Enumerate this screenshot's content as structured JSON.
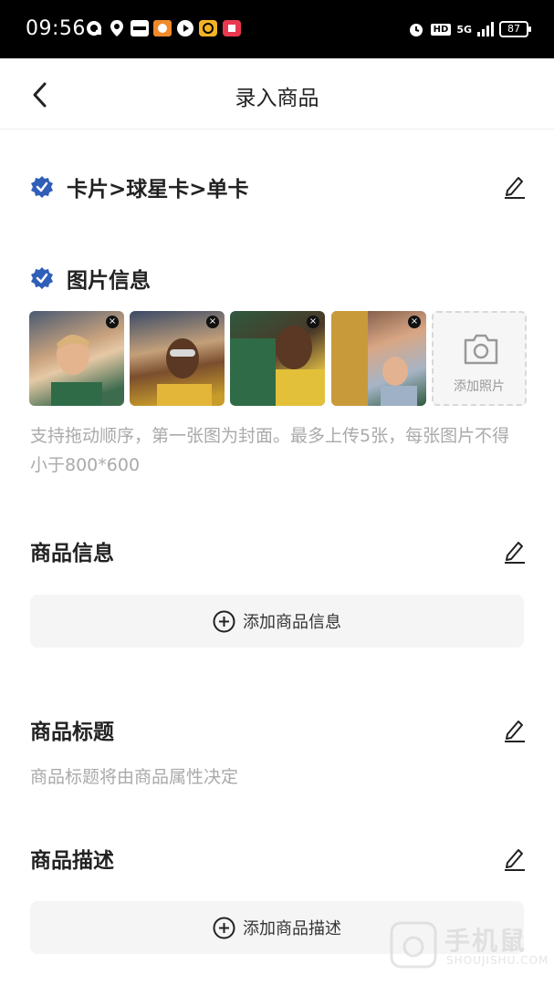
{
  "status_bar": {
    "time": "09:56",
    "network": "5G",
    "hd": "HD",
    "battery": "87",
    "app_icons": [
      "browser-icon",
      "location-icon",
      "youku-icon",
      "game-icon",
      "video-icon",
      "bell-app-icon",
      "red-app-icon"
    ]
  },
  "navbar": {
    "title": "录入商品"
  },
  "category": {
    "path": "卡片>球星卡>单卡"
  },
  "images": {
    "heading": "图片信息",
    "add_label": "添加照片",
    "count": 4,
    "hint": "支持拖动顺序，第一张图为封面。最多上传5张，每张图片不得小于800*600"
  },
  "product_info": {
    "title": "商品信息",
    "button": "添加商品信息"
  },
  "product_title": {
    "title": "商品标题",
    "hint": "商品标题将由商品属性决定"
  },
  "product_desc": {
    "title": "商品描述",
    "button": "添加商品描述"
  },
  "watermark": {
    "cn": "手机鼠",
    "en": "SHOUJISHU.COM"
  },
  "colors": {
    "accent": "#2f5fb8",
    "hint": "#aaaaaa",
    "button_bg": "#f5f5f5"
  }
}
